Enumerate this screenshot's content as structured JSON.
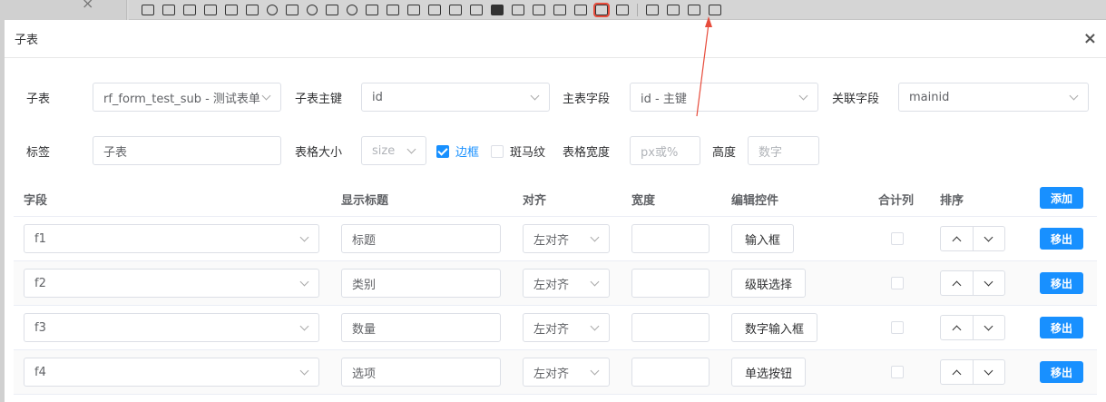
{
  "dialog": {
    "title": "子表",
    "close_icon": "×"
  },
  "form": {
    "subtable_label": "子表",
    "subtable_value": "rf_form_test_sub - 测试表单",
    "subkey_label": "子表主键",
    "subkey_value": "id",
    "mainfield_label": "主表字段",
    "mainfield_value": "id - 主键",
    "linkfield_label": "关联字段",
    "linkfield_value": "mainid",
    "tag_label": "标签",
    "tag_value": "子表",
    "tablesize_label": "表格大小",
    "tablesize_placeholder": "size",
    "border_label": "边框",
    "border_checked": true,
    "stripe_label": "斑马纹",
    "stripe_checked": false,
    "tablewidth_label": "表格宽度",
    "tablewidth_placeholder": "px或%",
    "height_label": "高度",
    "height_placeholder": "数字"
  },
  "table": {
    "headers": {
      "field": "字段",
      "title": "显示标题",
      "align": "对齐",
      "width": "宽度",
      "editor": "编辑控件",
      "sum": "合计列",
      "sort": "排序"
    },
    "add_label": "添加",
    "remove_label": "移出",
    "rows": [
      {
        "field": "f1",
        "title": "标题",
        "align": "左对齐",
        "width": "",
        "editor": "输入框",
        "sum": false
      },
      {
        "field": "f2",
        "title": "类别",
        "align": "左对齐",
        "width": "",
        "editor": "级联选择",
        "sum": false
      },
      {
        "field": "f3",
        "title": "数量",
        "align": "左对齐",
        "width": "",
        "editor": "数字输入框",
        "sum": false
      },
      {
        "field": "f4",
        "title": "选项",
        "align": "左对齐",
        "width": "",
        "editor": "单选按钮",
        "sum": false
      }
    ]
  },
  "colors": {
    "primary": "#1890ff",
    "annotation": "#e74c3c"
  }
}
